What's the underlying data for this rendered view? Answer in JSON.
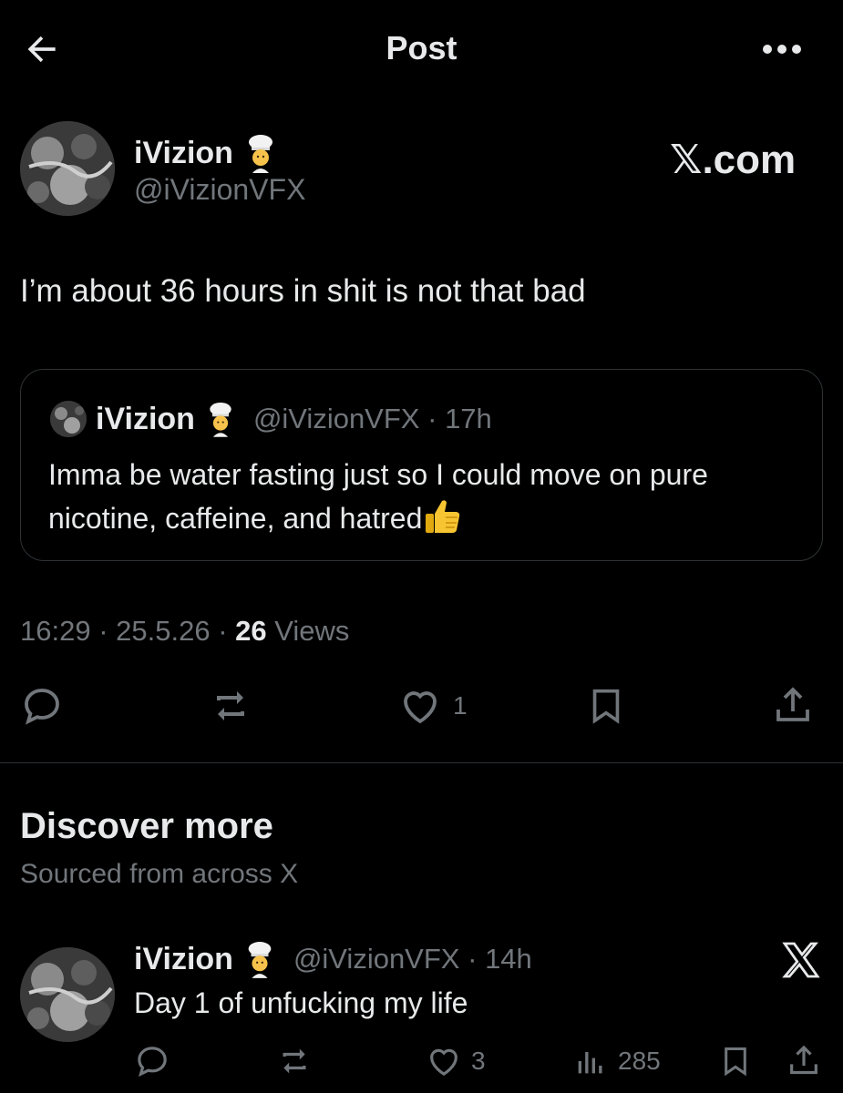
{
  "header": {
    "title": "Post"
  },
  "post": {
    "author_name": "iVizion",
    "author_emoji": "cook-emoji",
    "author_handle": "@iVizionVFX",
    "brand": "𝕏.com",
    "text": "I’m about 36 hours in shit is not that bad",
    "quote": {
      "author_name": "iVizion",
      "author_handle": "@iVizionVFX",
      "separator": "·",
      "age": "17h",
      "text": "Imma be water fasting just so I could move on pure nicotine, caffeine, and hatred",
      "trailing_emoji": "thumbs-up-emoji"
    },
    "time": "16:29",
    "date": "25.5.26",
    "separator": "·",
    "views_count": "26",
    "views_label": "Views",
    "actions": {
      "reply_icon": "reply-icon",
      "repost_icon": "repost-icon",
      "like_icon": "heart-icon",
      "like_count": "1",
      "bookmark_icon": "bookmark-icon",
      "share_icon": "share-icon"
    }
  },
  "discover": {
    "title": "Discover more",
    "subtitle": "Sourced from across X",
    "items": [
      {
        "author_name": "iVizion",
        "author_handle": "@iVizionVFX",
        "separator": "·",
        "age": "14h",
        "text": "Day 1 of unfucking my life",
        "like_count": "3",
        "views_count": "285",
        "brand_icon": "x-logo-icon"
      }
    ]
  },
  "colors": {
    "background": "#000000",
    "text_primary": "#e7e9ea",
    "text_secondary": "#71767b",
    "border": "#2f3336"
  }
}
